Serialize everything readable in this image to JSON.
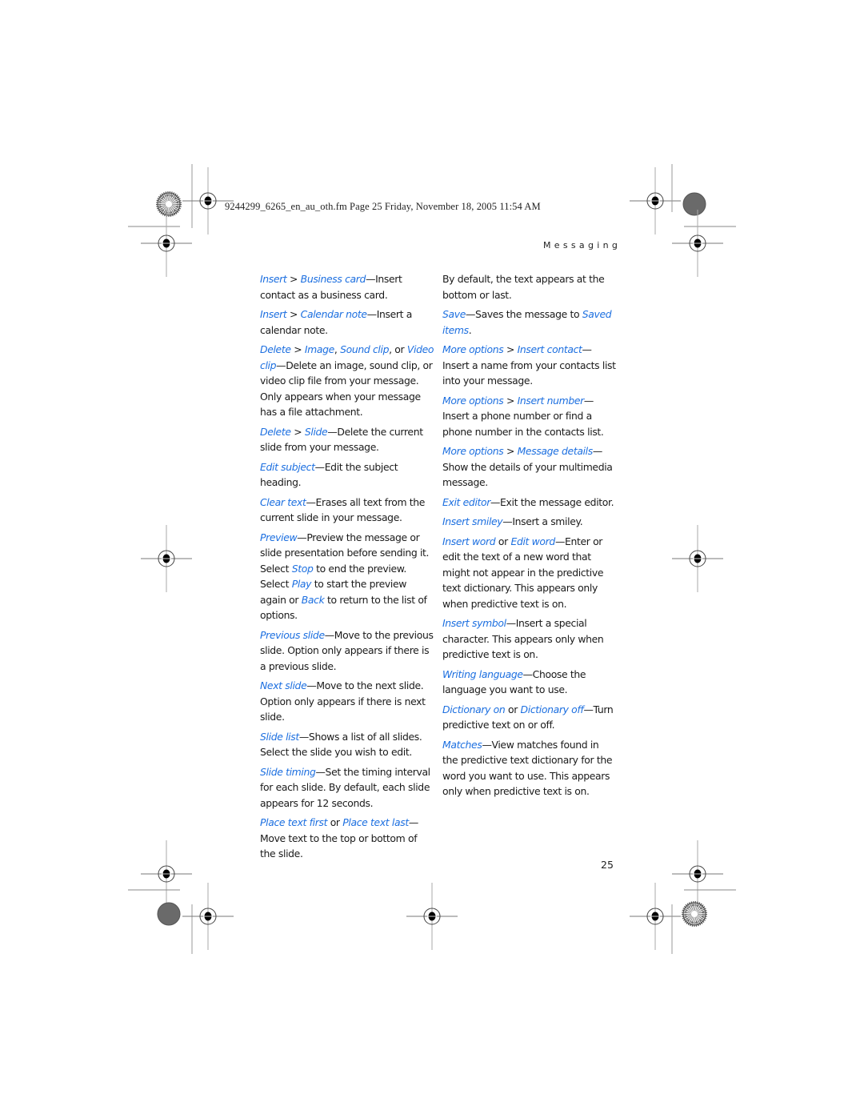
{
  "header": {
    "file_info": "9244299_6265_en_au_oth.fm  Page 25  Friday, November 18, 2005  11:54 AM",
    "section_title": "Messaging"
  },
  "left_column": [
    {
      "parts": [
        {
          "t": "Insert",
          "link": true
        },
        {
          "t": " > "
        },
        {
          "t": "Business card",
          "link": true
        },
        {
          "t": "—Insert contact as a business card."
        }
      ]
    },
    {
      "parts": [
        {
          "t": "Insert",
          "link": true
        },
        {
          "t": " > "
        },
        {
          "t": "Calendar note",
          "link": true
        },
        {
          "t": "—Insert a calendar note."
        }
      ]
    },
    {
      "parts": [
        {
          "t": "Delete",
          "link": true
        },
        {
          "t": " > "
        },
        {
          "t": "Image",
          "link": true
        },
        {
          "t": ", "
        },
        {
          "t": "Sound clip",
          "link": true
        },
        {
          "t": ", or "
        },
        {
          "t": "Video clip",
          "link": true
        },
        {
          "t": "—Delete an image, sound clip, or video clip file from your message. Only appears when your message has a file attachment."
        }
      ]
    },
    {
      "parts": [
        {
          "t": "Delete",
          "link": true
        },
        {
          "t": " > "
        },
        {
          "t": "Slide",
          "link": true
        },
        {
          "t": "—Delete the current slide from your message."
        }
      ]
    },
    {
      "parts": [
        {
          "t": "Edit subject",
          "link": true
        },
        {
          "t": "—Edit the subject heading."
        }
      ]
    },
    {
      "parts": [
        {
          "t": "Clear text",
          "link": true
        },
        {
          "t": "—Erases all text from the current slide in your message."
        }
      ]
    },
    {
      "parts": [
        {
          "t": "Preview",
          "link": true
        },
        {
          "t": "—Preview the message or slide presentation before sending it. Select "
        },
        {
          "t": "Stop",
          "link": true
        },
        {
          "t": " to end the preview. Select "
        },
        {
          "t": "Play",
          "link": true
        },
        {
          "t": " to start the preview again or "
        },
        {
          "t": "Back",
          "link": true
        },
        {
          "t": " to return to the list of options."
        }
      ]
    },
    {
      "parts": [
        {
          "t": "Previous slide",
          "link": true
        },
        {
          "t": "—Move to the previous slide. Option only appears if there is a previous slide."
        }
      ]
    },
    {
      "parts": [
        {
          "t": "Next slide",
          "link": true
        },
        {
          "t": "—Move to the next slide. Option only appears if there is next slide."
        }
      ]
    },
    {
      "parts": [
        {
          "t": "Slide list",
          "link": true
        },
        {
          "t": "—Shows a list of all slides. Select the slide you wish to edit."
        }
      ]
    },
    {
      "parts": [
        {
          "t": "Slide timing",
          "link": true
        },
        {
          "t": "—Set the timing interval for each slide. By default, each slide appears for 12 seconds."
        }
      ]
    },
    {
      "parts": [
        {
          "t": "Place text first",
          "link": true
        },
        {
          "t": " or "
        },
        {
          "t": "Place text last",
          "link": true
        },
        {
          "t": "—Move text to the top or bottom of the slide."
        }
      ]
    }
  ],
  "right_column": [
    {
      "parts": [
        {
          "t": "By default, the text appears at the bottom or last."
        }
      ]
    },
    {
      "parts": [
        {
          "t": "Save",
          "link": true
        },
        {
          "t": "—Saves the message to "
        },
        {
          "t": "Saved items",
          "link": true
        },
        {
          "t": "."
        }
      ]
    },
    {
      "parts": [
        {
          "t": "More options",
          "link": true
        },
        {
          "t": " > "
        },
        {
          "t": "Insert contact",
          "link": true
        },
        {
          "t": "—Insert a name from your contacts list into your message."
        }
      ]
    },
    {
      "parts": [
        {
          "t": "More options",
          "link": true
        },
        {
          "t": " > "
        },
        {
          "t": "Insert number",
          "link": true
        },
        {
          "t": "—Insert a phone number or find a phone number in the contacts list."
        }
      ]
    },
    {
      "parts": [
        {
          "t": "More options",
          "link": true
        },
        {
          "t": " > "
        },
        {
          "t": "Message details",
          "link": true
        },
        {
          "t": "—Show the details of your multimedia message."
        }
      ]
    },
    {
      "parts": [
        {
          "t": "Exit editor",
          "link": true
        },
        {
          "t": "—Exit the message editor."
        }
      ]
    },
    {
      "parts": [
        {
          "t": "Insert smiley",
          "link": true
        },
        {
          "t": "—Insert a smiley."
        }
      ]
    },
    {
      "parts": [
        {
          "t": "Insert word",
          "link": true
        },
        {
          "t": " or "
        },
        {
          "t": "Edit word",
          "link": true
        },
        {
          "t": "—Enter or edit the text of a new word that might not appear in the predictive text dictionary. This appears only when predictive text is on."
        }
      ]
    },
    {
      "parts": [
        {
          "t": "Insert symbol",
          "link": true
        },
        {
          "t": "—Insert a special character. This appears only when predictive text is on."
        }
      ]
    },
    {
      "parts": [
        {
          "t": "Writing language",
          "link": true
        },
        {
          "t": "—Choose the language you want to use."
        }
      ]
    },
    {
      "parts": [
        {
          "t": "Dictionary on",
          "link": true
        },
        {
          "t": " or "
        },
        {
          "t": "Dictionary off",
          "link": true
        },
        {
          "t": "—Turn predictive text on or off."
        }
      ]
    },
    {
      "parts": [
        {
          "t": "Matches",
          "link": true
        },
        {
          "t": "—View matches found in the predictive text dictionary for the word you want to use. This appears only when predictive text is on."
        }
      ]
    }
  ],
  "footer": {
    "page_number": "25"
  },
  "colors": {
    "link": "#1c6fe0",
    "text": "#1a1a1a"
  }
}
